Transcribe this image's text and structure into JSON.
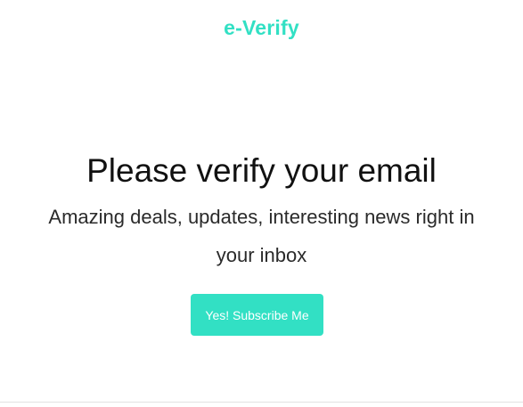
{
  "header": {
    "brand": "e-Verify"
  },
  "hero": {
    "title": "Please verify your email",
    "subtitle": "Amazing deals, updates, interesting news right in your inbox",
    "button_label": "Yes! Subscribe Me"
  },
  "colors": {
    "accent": "#32e0c4",
    "text_dark": "#111111",
    "text_body": "#2a2a2a",
    "background": "#ffffff"
  }
}
